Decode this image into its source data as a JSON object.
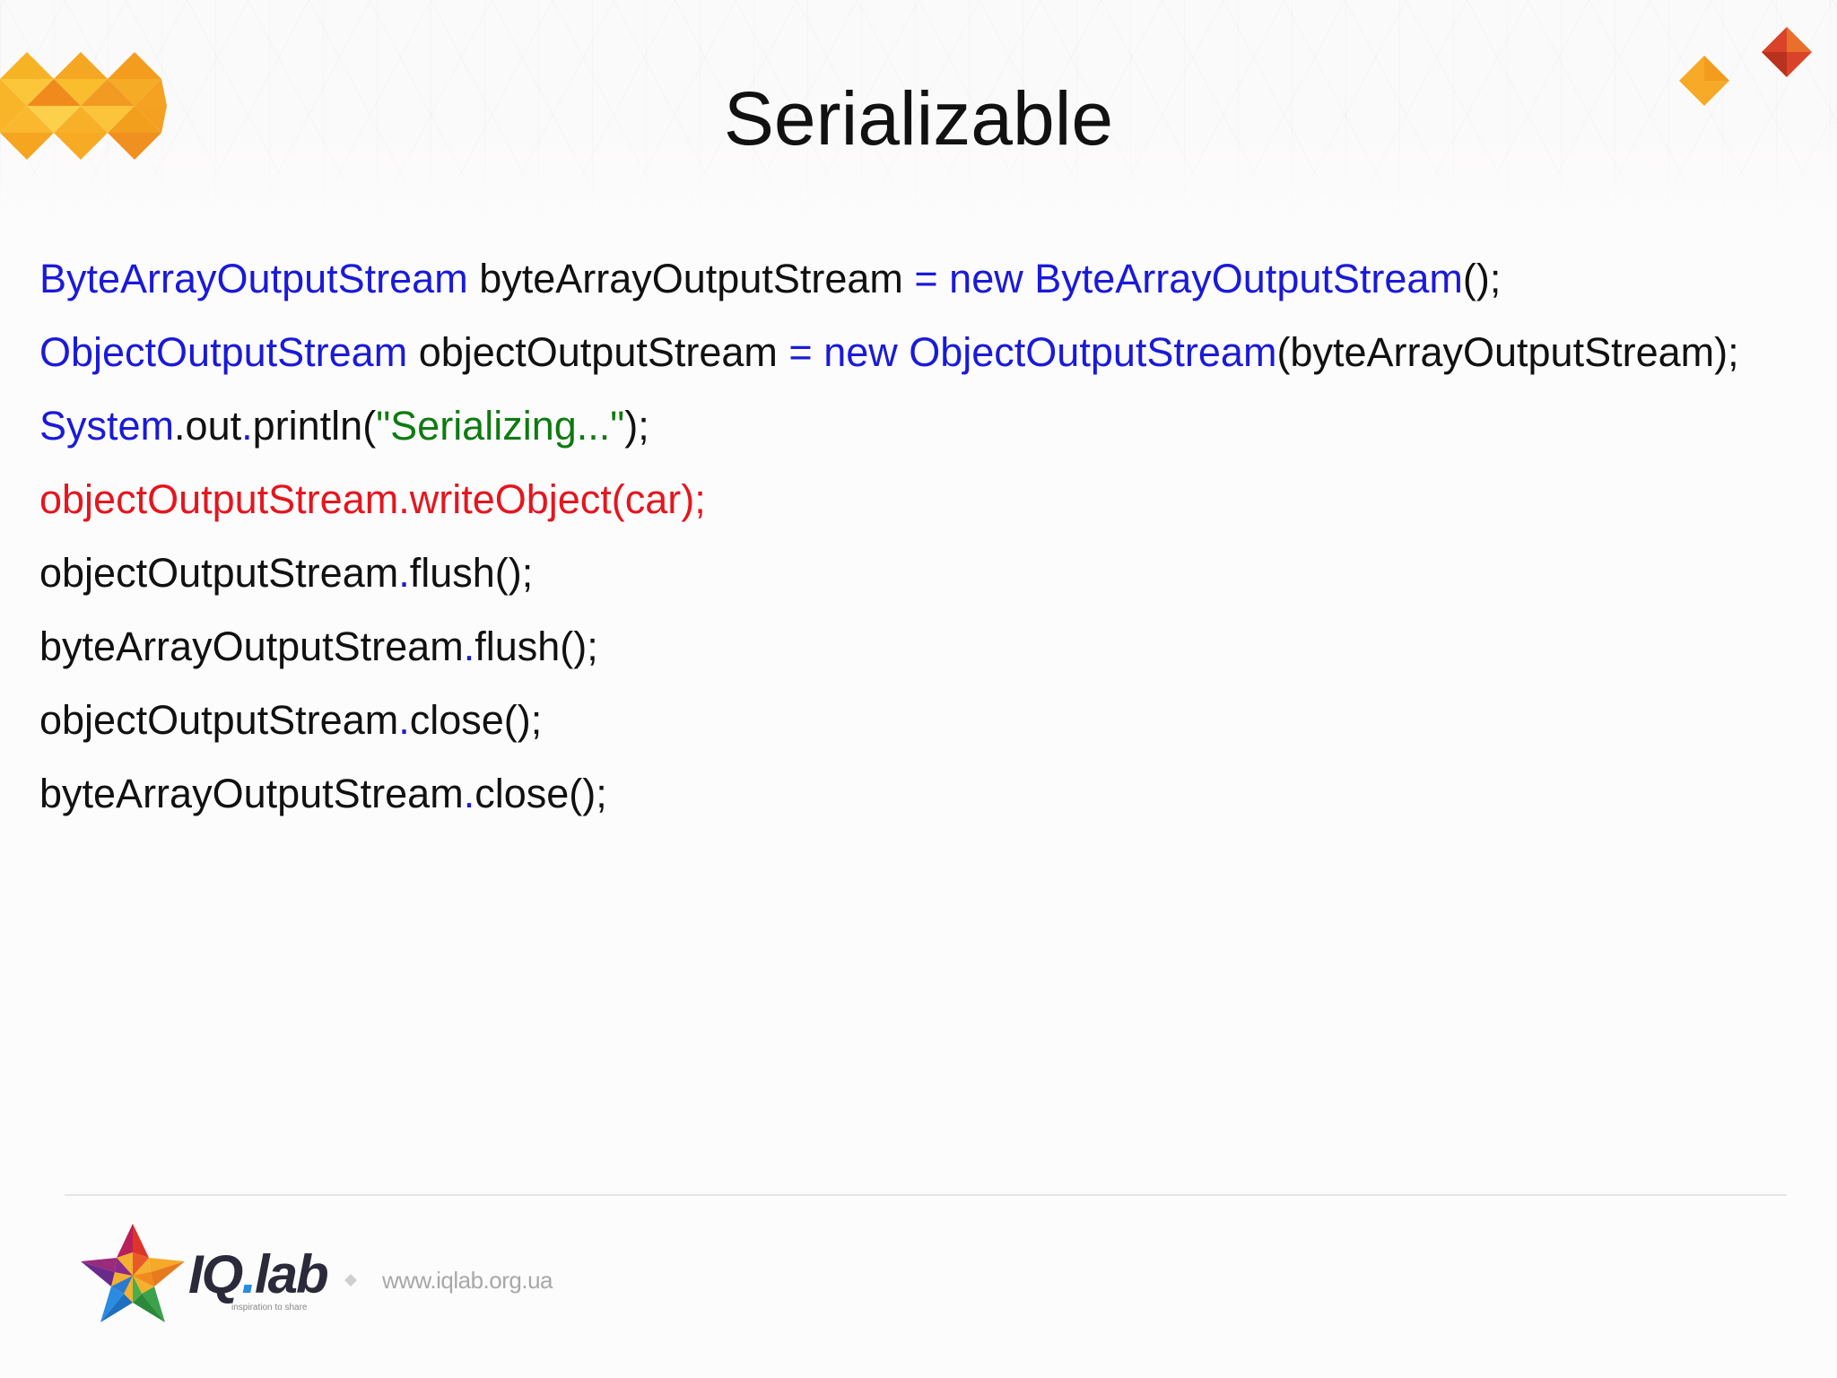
{
  "slide": {
    "title": "Serializable",
    "code_lines": [
      [
        {
          "text": "ByteArrayOutputStream",
          "color": "blue"
        },
        {
          "text": " byteArrayOutputStream ",
          "color": "dark"
        },
        {
          "text": "= new ByteArrayOutputStream",
          "color": "blue"
        },
        {
          "text": "();",
          "color": "dark"
        }
      ],
      [
        {
          "text": "ObjectOutputStream",
          "color": "blue"
        },
        {
          "text": " objectOutputStream ",
          "color": "dark"
        },
        {
          "text": "= new ObjectOutputStream",
          "color": "blue"
        },
        {
          "text": "(byteArrayOutputStream);",
          "color": "dark"
        }
      ],
      [
        {
          "text": "System",
          "color": "blue"
        },
        {
          "text": ".",
          "color": "dark"
        },
        {
          "text": "out",
          "color": "dark"
        },
        {
          "text": ".",
          "color": "blue"
        },
        {
          "text": "println(",
          "color": "dark"
        },
        {
          "text": "\"Serializing...\"",
          "color": "green"
        },
        {
          "text": ");",
          "color": "dark"
        }
      ],
      [
        {
          "text": "objectOutputStream.writeObject(car);",
          "color": "red"
        }
      ],
      [
        {
          "text": "objectOutputStream",
          "color": "dark"
        },
        {
          "text": ".",
          "color": "blue"
        },
        {
          "text": "flush();",
          "color": "dark"
        }
      ],
      [
        {
          "text": "byteArrayOutputStream",
          "color": "dark"
        },
        {
          "text": ".",
          "color": "blue"
        },
        {
          "text": "flush();",
          "color": "dark"
        }
      ],
      [
        {
          "text": "objectOutputStream",
          "color": "dark"
        },
        {
          "text": ".",
          "color": "blue"
        },
        {
          "text": "close();",
          "color": "dark"
        }
      ],
      [
        {
          "text": "byteArrayOutputStream",
          "color": "dark"
        },
        {
          "text": ".",
          "color": "blue"
        },
        {
          "text": "close();",
          "color": "dark"
        }
      ]
    ]
  },
  "footer": {
    "brand_name_prefix": "IQ",
    "brand_name_dot": ".",
    "brand_name_suffix": "lab",
    "brand_tagline": "inspiration to share",
    "url": "www.iqlab.org.ua",
    "logo_icon": "star-logo-icon",
    "separator_icon": "diamond-icon"
  },
  "colors": {
    "code_blue": "#1a1ad8",
    "code_dark": "#111111",
    "code_green": "#0f7a12",
    "code_red": "#e4161e",
    "accent_orange": "#f39c1e",
    "accent_red": "#d9432a"
  }
}
